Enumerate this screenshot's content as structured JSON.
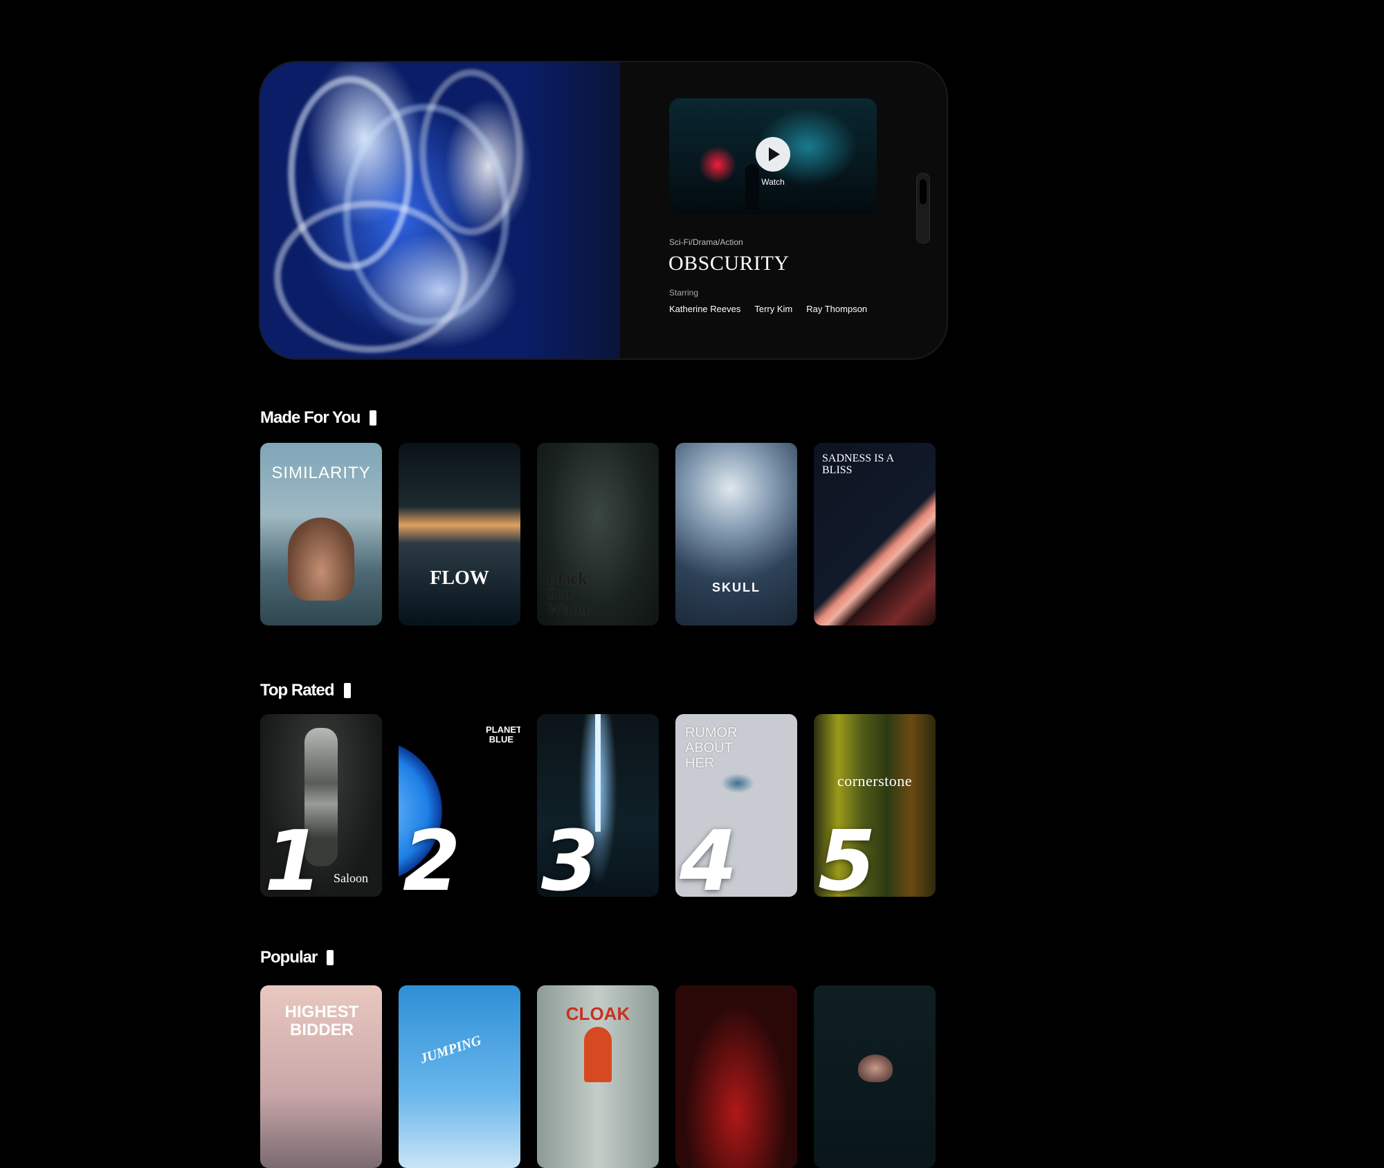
{
  "hero": {
    "genre": "Sci-Fi/Drama/Action",
    "title": "OBSCURITY",
    "watch_label": "Watch",
    "starring_label": "Starring",
    "cast": [
      "Katherine Reeves",
      "Terry Kim",
      "Ray Thompson"
    ]
  },
  "sections": {
    "s1": {
      "title": "Made For You",
      "posters": [
        {
          "text": "SIMILARITY"
        },
        {
          "text": "FLOW"
        },
        {
          "text": "Black Sea Water"
        },
        {
          "text": "SKULL"
        },
        {
          "text": "SADNESS IS A BLISS"
        }
      ]
    },
    "s2": {
      "title": "Top Rated",
      "posters": [
        {
          "text": "Saloon",
          "rank": "1"
        },
        {
          "text": "PLANET BLUE",
          "rank": "2"
        },
        {
          "text": "",
          "rank": "3"
        },
        {
          "text": "RUMOR ABOUT HER",
          "rank": "4"
        },
        {
          "text": "cornerstone",
          "rank": "5"
        }
      ]
    },
    "s3": {
      "title": "Popular",
      "posters": [
        {
          "text": "HIGHEST BIDDER"
        },
        {
          "text": "JUMPING"
        },
        {
          "text": "CLOAK"
        },
        {
          "text": ""
        },
        {
          "text": ""
        }
      ]
    }
  },
  "colors": {
    "background": "#000000",
    "hero_panel": "#0b0b0b",
    "text": "#ffffff"
  }
}
